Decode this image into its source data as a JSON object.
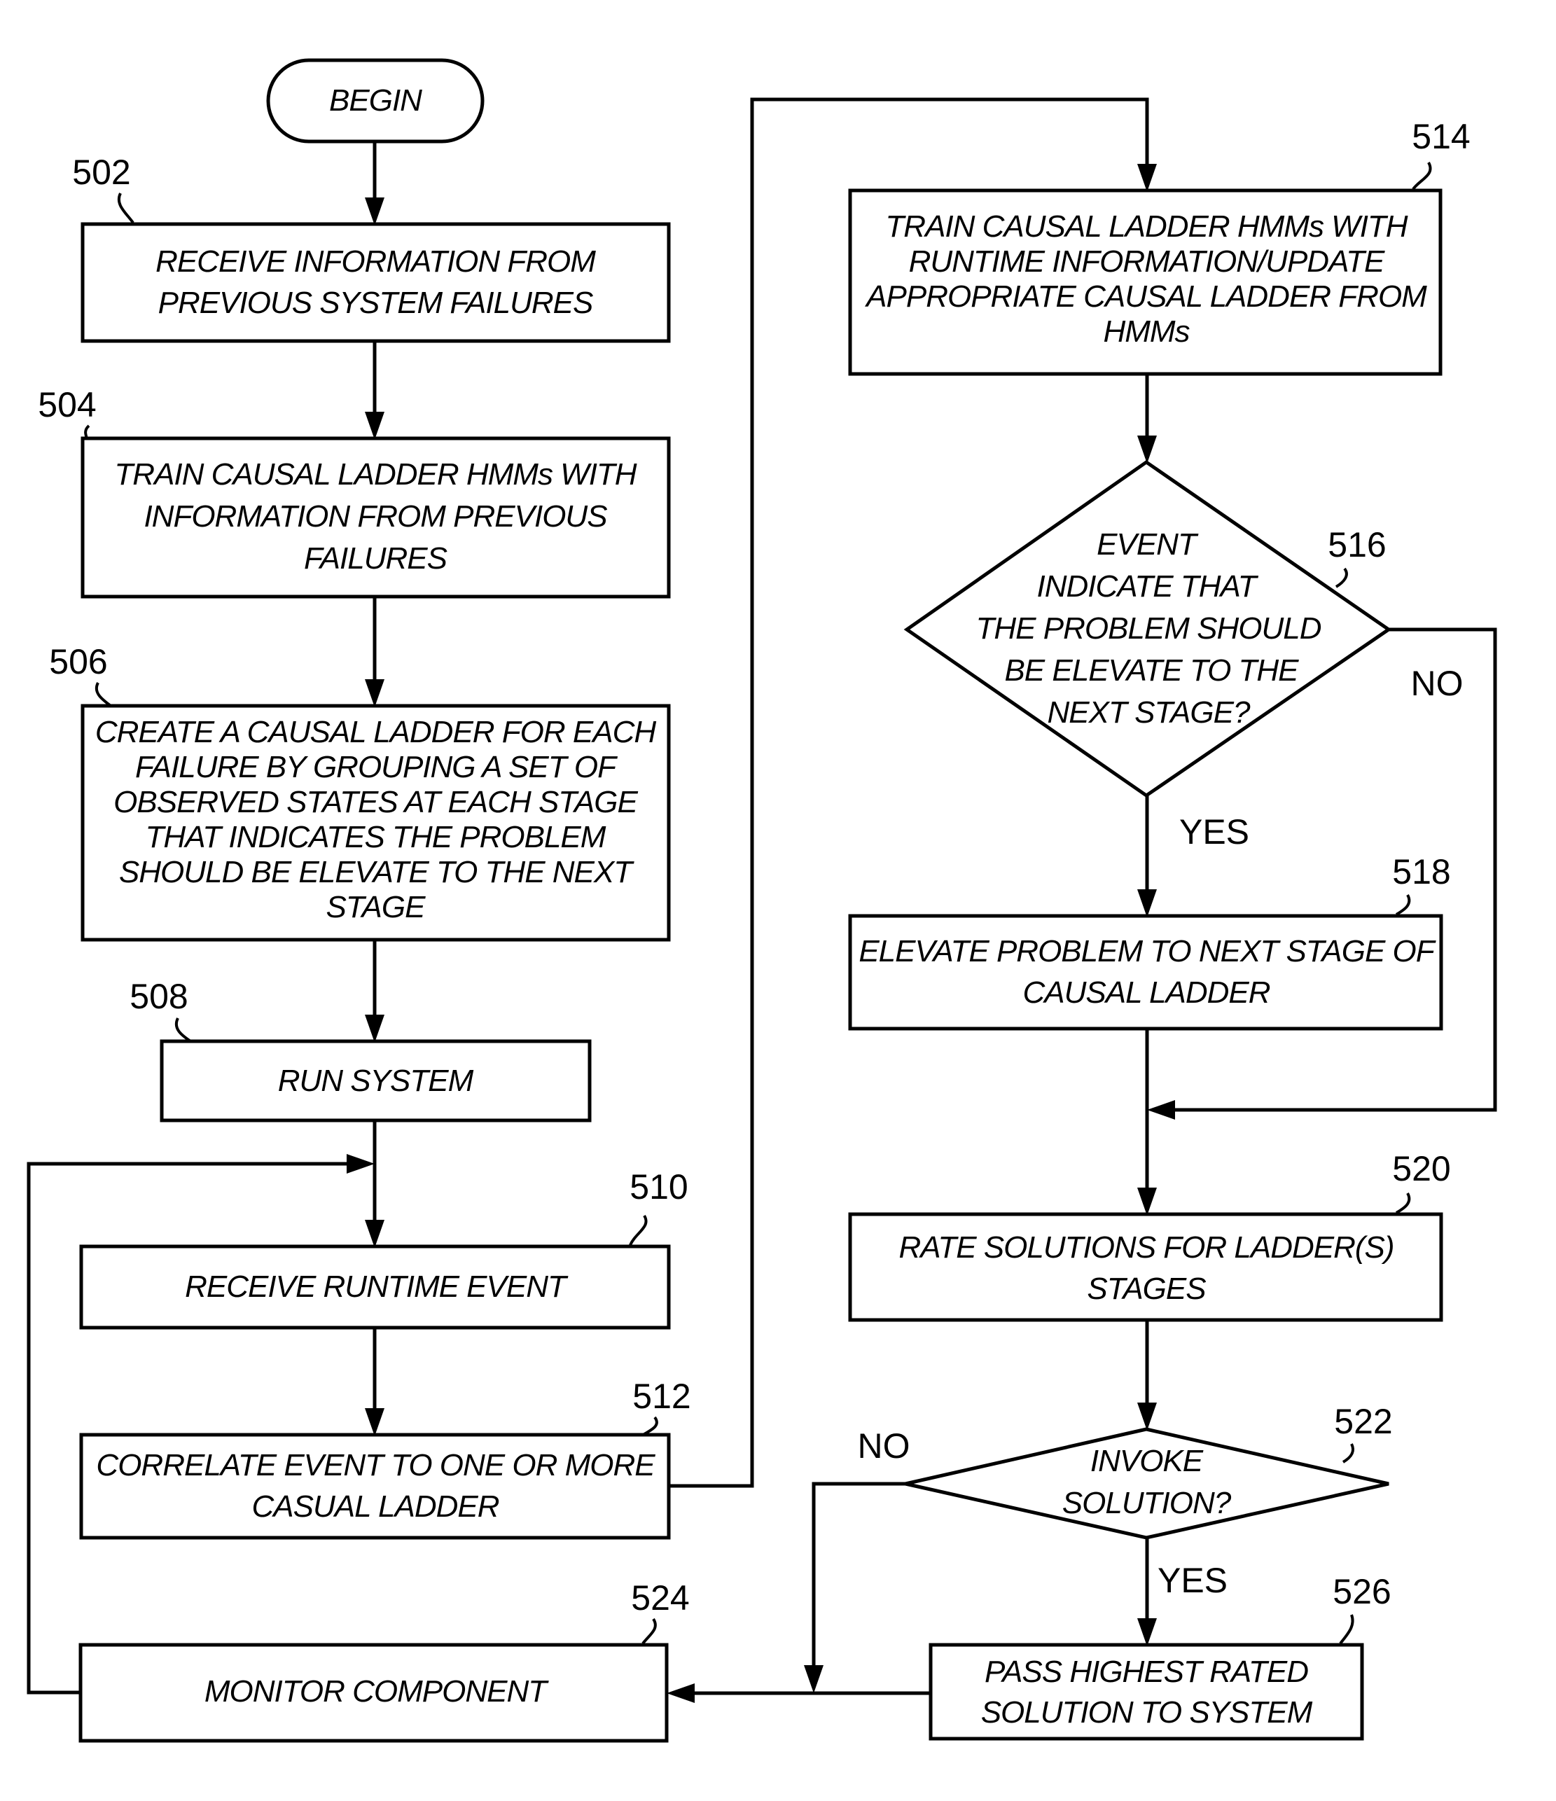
{
  "figure": {
    "type": "flowchart",
    "start": {
      "label": "BEGIN"
    },
    "steps": [
      {
        "id": "502",
        "ref": "502",
        "lines": [
          "RECEIVE INFORMATION FROM",
          "PREVIOUS SYSTEM FAILURES"
        ]
      },
      {
        "id": "504",
        "ref": "504",
        "lines": [
          "TRAIN CAUSAL LADDER HMMs WITH",
          "INFORMATION FROM PREVIOUS",
          "FAILURES"
        ]
      },
      {
        "id": "506",
        "ref": "506",
        "lines": [
          "CREATE A CAUSAL LADDER FOR EACH",
          "FAILURE BY GROUPING A SET OF",
          "OBSERVED STATES AT EACH STAGE",
          "THAT INDICATES THE PROBLEM",
          "SHOULD BE ELEVATE TO THE NEXT",
          "STAGE"
        ]
      },
      {
        "id": "508",
        "ref": "508",
        "lines": [
          "RUN SYSTEM"
        ]
      },
      {
        "id": "510",
        "ref": "510",
        "lines": [
          "RECEIVE RUNTIME EVENT"
        ]
      },
      {
        "id": "512",
        "ref": "512",
        "lines": [
          "CORRELATE EVENT TO ONE OR MORE",
          "CASUAL LADDER"
        ]
      },
      {
        "id": "514",
        "ref": "514",
        "lines": [
          "TRAIN CAUSAL LADDER HMMs WITH",
          "RUNTIME INFORMATION/UPDATE",
          "APPROPRIATE CAUSAL LADDER FROM",
          "HMMs"
        ]
      },
      {
        "id": "518",
        "ref": "518",
        "lines": [
          "ELEVATE PROBLEM TO NEXT STAGE OF",
          "CAUSAL LADDER"
        ]
      },
      {
        "id": "520",
        "ref": "520",
        "lines": [
          "RATE SOLUTIONS FOR LADDER(S)",
          "STAGES"
        ]
      },
      {
        "id": "524",
        "ref": "524",
        "lines": [
          "MONITOR COMPONENT"
        ]
      },
      {
        "id": "526",
        "ref": "526",
        "lines": [
          "PASS HIGHEST RATED",
          "SOLUTION TO SYSTEM"
        ]
      }
    ],
    "decisions": [
      {
        "id": "516",
        "ref": "516",
        "lines": [
          "EVENT",
          "INDICATE THAT",
          "THE PROBLEM SHOULD",
          "BE ELEVATE TO THE",
          "NEXT STAGE?"
        ],
        "yes_label": "YES",
        "no_label": "NO"
      },
      {
        "id": "522",
        "ref": "522",
        "lines": [
          "INVOKE",
          "SOLUTION?"
        ],
        "yes_label": "YES",
        "no_label": "NO"
      }
    ]
  }
}
